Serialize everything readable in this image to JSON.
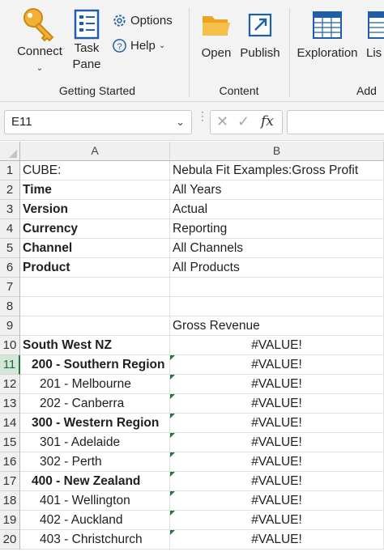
{
  "ribbon": {
    "getting_started": {
      "connect_label": "Connect",
      "task_label_line1": "Task",
      "task_label_line2": "Pane",
      "options_label": "Options",
      "help_label": "Help",
      "group_label": "Getting Started"
    },
    "content": {
      "open_label": "Open",
      "publish_label": "Publish",
      "group_label": "Content"
    },
    "add": {
      "exploration_label": "Exploration",
      "list_label": "Lis",
      "group_label": "Add"
    }
  },
  "formula_bar": {
    "name_box": "E11",
    "fx_label": "fx",
    "formula": ""
  },
  "grid": {
    "columns": [
      "A",
      "B"
    ],
    "rows": [
      {
        "n": "1",
        "a": "CUBE:",
        "b": "Nebula Fit Examples:Gross Profit"
      },
      {
        "n": "2",
        "a": "Time",
        "b": "All Years"
      },
      {
        "n": "3",
        "a": "Version",
        "b": "Actual"
      },
      {
        "n": "4",
        "a": "Currency",
        "b": "Reporting"
      },
      {
        "n": "5",
        "a": "Channel",
        "b": "All Channels"
      },
      {
        "n": "6",
        "a": "Product",
        "b": "All Products"
      },
      {
        "n": "7",
        "a": "",
        "b": ""
      },
      {
        "n": "8",
        "a": "",
        "b": ""
      },
      {
        "n": "9",
        "a": "",
        "b": "Gross Revenue"
      },
      {
        "n": "10",
        "a": "South West NZ",
        "b": "#VALUE!"
      },
      {
        "n": "11",
        "a": "200 - Southern Region",
        "b": "#VALUE!"
      },
      {
        "n": "12",
        "a": "201 - Melbourne",
        "b": "#VALUE!"
      },
      {
        "n": "13",
        "a": "202 - Canberra",
        "b": "#VALUE!"
      },
      {
        "n": "14",
        "a": "300 - Western Region",
        "b": "#VALUE!"
      },
      {
        "n": "15",
        "a": "301 - Adelaide",
        "b": "#VALUE!"
      },
      {
        "n": "16",
        "a": "302 - Perth",
        "b": "#VALUE!"
      },
      {
        "n": "17",
        "a": "400 - New Zealand",
        "b": "#VALUE!"
      },
      {
        "n": "18",
        "a": "401 - Wellington",
        "b": "#VALUE!"
      },
      {
        "n": "19",
        "a": "402 - Auckland",
        "b": "#VALUE!"
      },
      {
        "n": "20",
        "a": "403 - Christchurch",
        "b": "#VALUE!"
      }
    ]
  },
  "colors": {
    "ribbon_bg": "#f3f3f3",
    "accent_green": "#1e7b3c",
    "icon_blue": "#1f5fa8",
    "folder_yellow": "#f2b134"
  },
  "icons": [
    "key-icon",
    "task-pane-icon",
    "gear-icon",
    "help-icon",
    "folder-icon",
    "publish-icon",
    "exploration-icon",
    "list-icon"
  ]
}
